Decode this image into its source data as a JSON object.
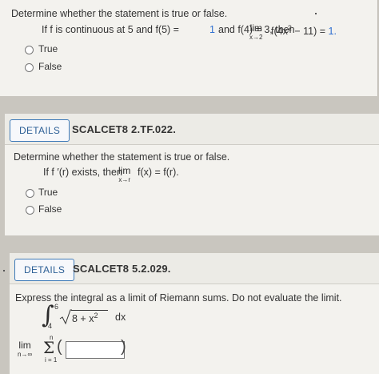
{
  "q1": {
    "instruction": "Determine whether the statement is true or false.",
    "stmt_a": "If f is continuous at 5 and f(5) =",
    "val_a": "1",
    "stmt_b": "and f(4) = 3, then",
    "lim_word": "lim",
    "lim_sub": "x→2",
    "stmt_c": "f(4x",
    "stmt_sup": "2",
    "stmt_d": "− 11) =",
    "val_b": "1.",
    "options": [
      "True",
      "False"
    ]
  },
  "q2": {
    "details_label": "DETAILS",
    "code": "SCALCET8 2.TF.022.",
    "instruction": "Determine whether the statement is true or false.",
    "stmt_a": "If f ′(r) exists, then",
    "lim_word": "lim",
    "lim_sub": "x→r",
    "stmt_b": "f(x) = f(r).",
    "options": [
      "True",
      "False"
    ]
  },
  "q3": {
    "details_label": "DETAILS",
    "code": "SCALCET8 5.2.029.",
    "instruction": "Express the integral as a limit of Riemann sums. Do not evaluate the limit.",
    "int_upper": "6",
    "int_lower": "4",
    "integrand": "8 + x",
    "integrand_sup": "2",
    "dx": "dx",
    "lim_word": "lim",
    "lim_sub": "n→∞",
    "sum_upper": "n",
    "sum_lower": "i = 1",
    "answer": ""
  }
}
